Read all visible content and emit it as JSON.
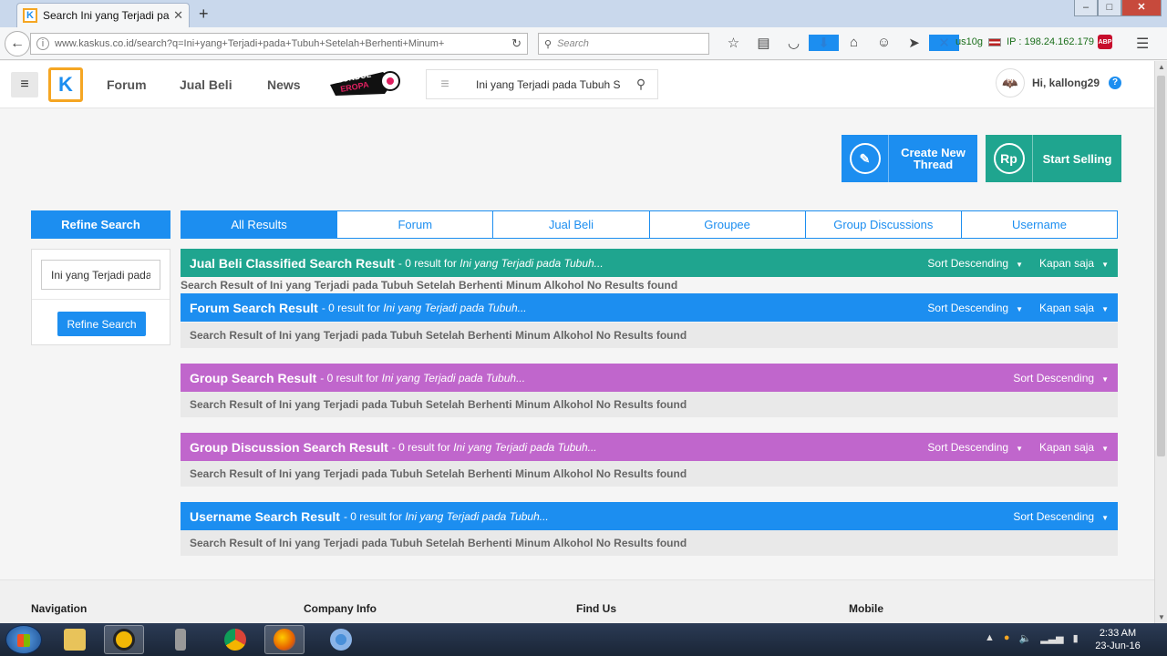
{
  "browser": {
    "tab_title": "Search Ini yang Terjadi pad...",
    "url": "www.kaskus.co.id/search?q=Ini+yang+Terjadi+pada+Tubuh+Setelah+Berhenti+Minum+",
    "search_placeholder": "Search",
    "extension_user": "us10g",
    "ip_text": "IP : 198.24.162.179",
    "abp_label": "ABP"
  },
  "site": {
    "nav": [
      "Forum",
      "Jual Beli",
      "News"
    ],
    "promo_text": [
      "BUNDUL",
      "EROPA"
    ],
    "search_value": "Ini yang Terjadi pada Tubuh S",
    "greeting": "Hi, kallong29",
    "create_thread_label_1": "Create New",
    "create_thread_label_2": "Thread",
    "create_icon_glyph": "✎",
    "sell_icon_glyph": "Rp",
    "start_selling_label": "Start Selling"
  },
  "refine": {
    "heading": "Refine Search",
    "input_value": "Ini yang Terjadi pada",
    "button_label": "Refine Search"
  },
  "tabs": [
    "All Results",
    "Forum",
    "Jual Beli",
    "Groupee",
    "Group Discussions",
    "Username"
  ],
  "results": [
    {
      "title": "Jual Beli Classified Search Result",
      "count_text": " - 0 result for ",
      "query": "Ini yang Terjadi pada Tubuh...",
      "sort": "Sort Descending",
      "time": "Kapan saja",
      "body": "Search Result of Ini yang Terjadi pada Tubuh Setelah Berhenti Minum Alkohol No Results found",
      "color": "#1fa58f"
    },
    {
      "title": "Forum Search Result",
      "count_text": " - 0 result for ",
      "query": "Ini yang Terjadi pada Tubuh...",
      "sort": "Sort Descending",
      "time": "Kapan saja",
      "body": "Search Result of Ini yang Terjadi pada Tubuh Setelah Berhenti Minum Alkohol No Results found",
      "color": "#1c8ef0"
    },
    {
      "title": "Group Search Result",
      "count_text": " - 0 result for ",
      "query": "Ini yang Terjadi pada Tubuh...",
      "sort": "Sort Descending",
      "body": "Search Result of Ini yang Terjadi pada Tubuh Setelah Berhenti Minum Alkohol No Results found",
      "color": "#c066cc"
    },
    {
      "title": "Group Discussion Search Result",
      "count_text": " - 0 result for ",
      "query": "Ini yang Terjadi pada Tubuh...",
      "sort": "Sort Descending",
      "time": "Kapan saja",
      "body": "Search Result of Ini yang Terjadi pada Tubuh Setelah Berhenti Minum Alkohol No Results found",
      "color": "#c066cc"
    },
    {
      "title": "Username Search Result",
      "count_text": " - 0 result for ",
      "query": "Ini yang Terjadi pada Tubuh...",
      "sort": "Sort Descending",
      "body": "Search Result of Ini yang Terjadi pada Tubuh Setelah Berhenti Minum Alkohol No Results found",
      "color": "#1c8ef0"
    }
  ],
  "footer": [
    "Navigation",
    "Company Info",
    "Find Us",
    "Mobile"
  ],
  "taskbar": {
    "time": "2:33 AM",
    "date": "23-Jun-16"
  }
}
